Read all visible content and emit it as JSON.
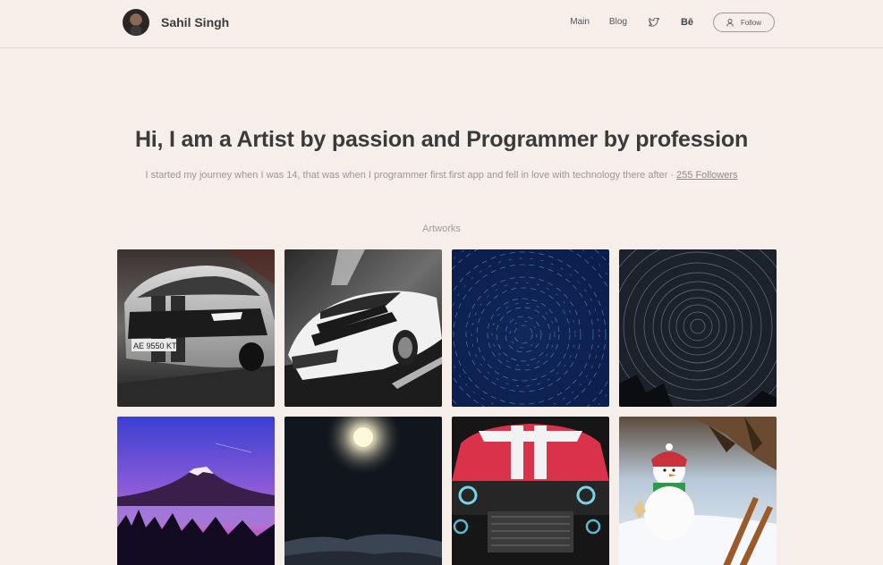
{
  "header": {
    "name": "Sahil Singh",
    "nav": {
      "main": "Main",
      "blog": "Blog"
    },
    "behance_label": "Bē",
    "follow_label": "Follow",
    "icons": [
      "twitter-icon",
      "behance-icon",
      "user-icon"
    ]
  },
  "hero": {
    "title": "Hi, I am a Artist by passion and Programmer by profession",
    "subtitle": "I started my journey when I was 14, that was when I programmer first first app and fell in love with technology there after",
    "separator": "·",
    "followers": "255 Followers"
  },
  "artworks": {
    "label": "Artworks",
    "items": [
      {
        "subject": "Silver Ford Mustang with plate",
        "plate": "AE 9550 KT"
      },
      {
        "subject": "White Ford GT with black stripes"
      },
      {
        "subject": "Blue star trails"
      },
      {
        "subject": "Grey star trail vortex"
      },
      {
        "subject": "Mount Fuji at purple dusk"
      },
      {
        "subject": "Moon over dark mountains"
      },
      {
        "subject": "Red muscle car front"
      },
      {
        "subject": "Snowman figurine in snow"
      }
    ]
  },
  "colors": {
    "background": "#f6efe9",
    "text": "#3a3a3a",
    "muted": "#9b9794"
  }
}
